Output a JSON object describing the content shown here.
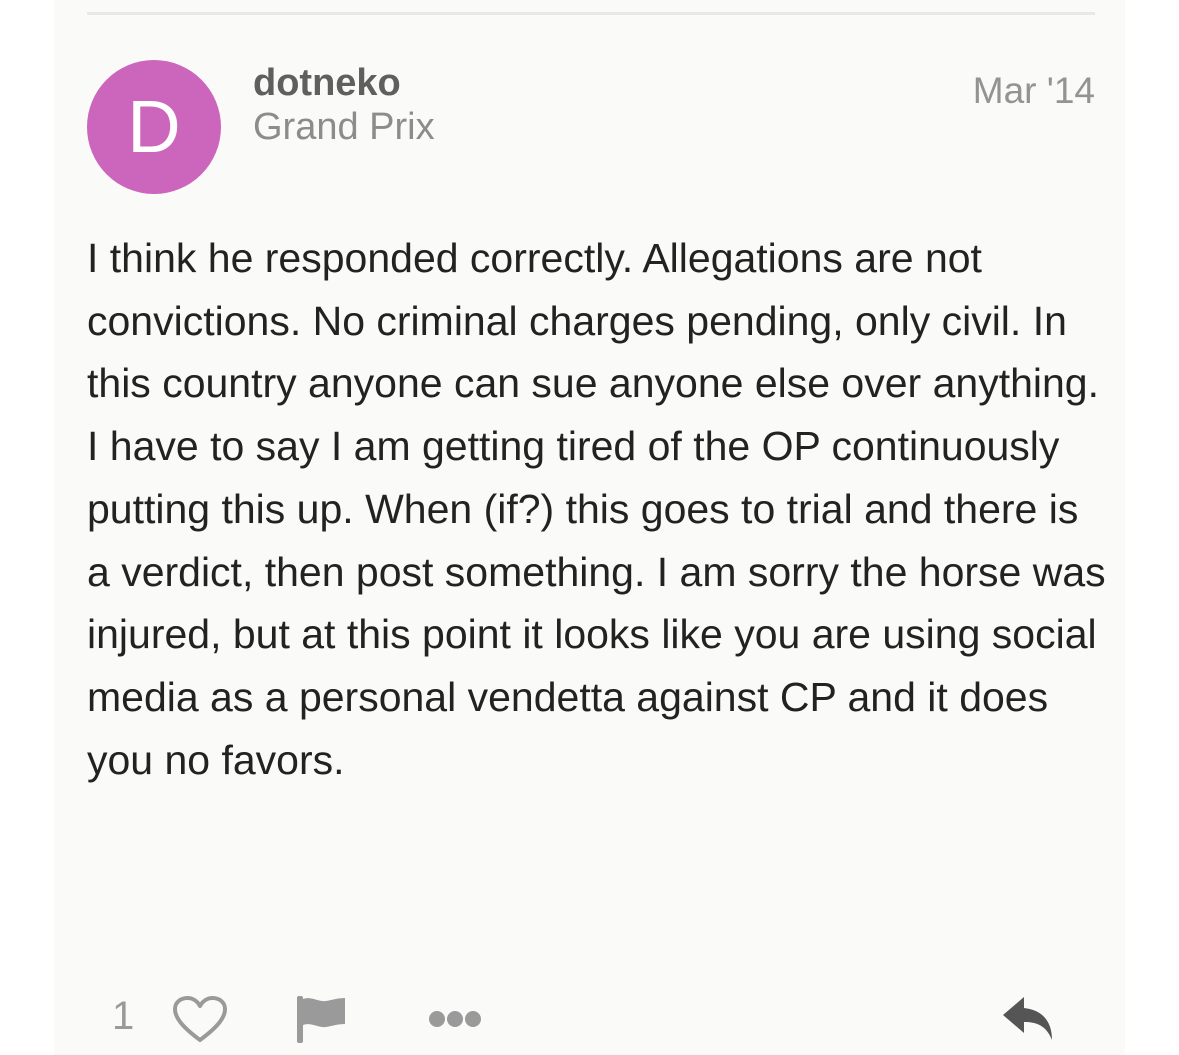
{
  "post": {
    "avatar_letter": "D",
    "avatar_color": "#cc66bd",
    "username": "dotneko",
    "user_title": "Grand Prix",
    "date": "Mar '14",
    "body": [
      "I think he responded correctly. Allegations are not convictions. No criminal charges pending, only civil. In this country anyone can sue anyone else over anything.",
      "I have to say I am getting tired of the OP continuously putting this up. When (if?) this goes to trial and there is a verdict, then post something. I am sorry the horse was injured, but at this point it looks like you are using social media as a personal vendetta against CP and it does you no favors."
    ]
  },
  "actions": {
    "like_count": "1",
    "icons": [
      "heart-icon",
      "flag-icon",
      "more-icon",
      "reply-icon"
    ]
  }
}
